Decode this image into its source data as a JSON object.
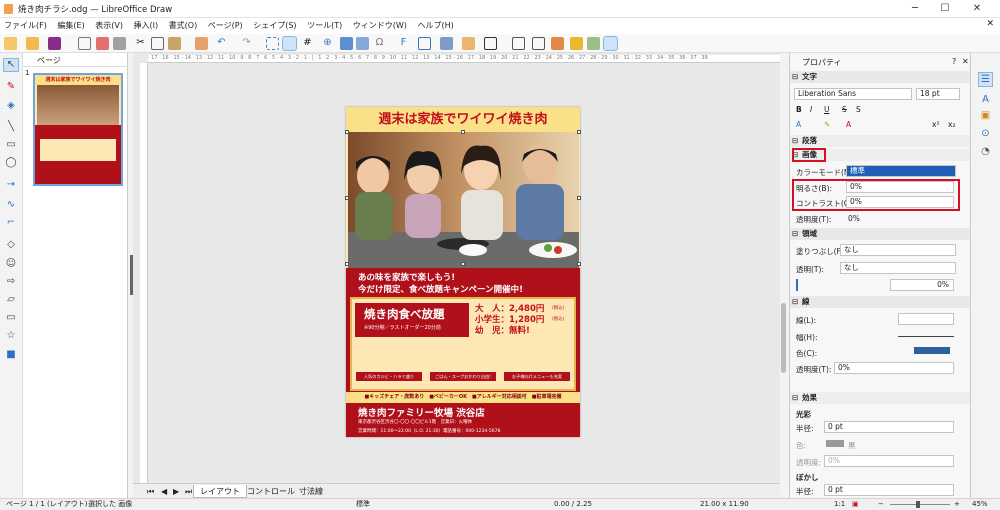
{
  "window": {
    "title": "焼き肉チラシ.odg — LibreOffice Draw",
    "minimize": "─",
    "maximize": "☐",
    "close": "✕"
  },
  "menu": [
    "ファイル(F)",
    "編集(E)",
    "表示(V)",
    "挿入(I)",
    "書式(O)",
    "ページ(P)",
    "シェイプ(S)",
    "ツール(T)",
    "ウィンドウ(W)",
    "ヘルプ(H)"
  ],
  "menu_close": "✕",
  "pages_panel": {
    "title": "ページ",
    "page_number": "1",
    "close": "✕"
  },
  "flyer": {
    "title": "週末は家族でワイワイ焼き肉",
    "tagline1": "あの味を家族で楽しもう!",
    "tagline2": "今だけ限定、食べ放題キャンペーン開催中!",
    "buffet": "焼き肉食べ放題",
    "buffet_note": "※90分制／ラストオーダー20分前",
    "price_adult": "大　人：2,480円",
    "price_child": "小学生：1,280円",
    "price_infant": "幼　児：無料!",
    "tax": "(税込)",
    "sub1": "人気のカルビ・ハラミ盛り",
    "sub2": "ごはん・スープおかわり自由!",
    "sub3": "お子様向けメニューも充実",
    "features": "■キッズチェア・席数あり　■ベビーカーOK　■アレルギー対応相談可　■駐車場完備",
    "store": "焼き肉ファミリー牧場 渋谷店",
    "address": "東京都渋谷区渋谷〇-〇〇-〇〇ビル1階　営業日：火曜休",
    "hours": "営業時間：11:00〜22:00（L.O. 21:30）電話番号：000-1234-5678"
  },
  "ruler_text": "· 17 · 16 · 15 · 14 · 13 · 12 · 11 · 10 · 9 · 8 · 7 · 6 · 5 · 4 · 3 · 2 · 1 · | · 1 · 2 · 3 · 4 · 5 · 6 · 7 · 8 · 9 · 10 · 11 · 12 · 13 · 14 · 15 · 16 · 17 · 18 · 19 · 20 · 21 · 22 · 23 · 24 · 25 · 26 · 27 · 28 · 29 · 30 · 31 · 32 · 33 · 34 · 35 · 36 · 37 · 38",
  "tabs": [
    "レイアウト",
    "コントロール",
    "寸法線"
  ],
  "tab_nav": [
    "⏮",
    "◀",
    "▶",
    "⏭"
  ],
  "properties": {
    "title": "プロパティ",
    "help": "?",
    "close": "✕",
    "character": {
      "label": "文字",
      "font": "Liberation Sans",
      "size": "18 pt"
    },
    "paragraph": {
      "label": "段落"
    },
    "image": {
      "label": "画像",
      "color_mode_label": "カラーモード(M):",
      "color_mode": "標準",
      "brightness_label": "明るさ(B):",
      "brightness": "0%",
      "contrast_label": "コントラスト(C):",
      "contrast": "0%",
      "transparency_label": "透明度(T):",
      "transparency": "0%"
    },
    "area": {
      "label": "領域",
      "fill_label": "塗りつぶし(F):",
      "fill": "なし",
      "transp_label": "透明(T):",
      "transp": "なし",
      "pct": "0%"
    },
    "line": {
      "label": "線",
      "style_label": "線(L):",
      "width_label": "幅(H):",
      "color_label": "色(C):",
      "transp_label": "透明度(T):",
      "transp": "0%"
    },
    "effects": {
      "label": "効果",
      "glow": "光彩",
      "radius_label": "半径:",
      "radius": "0 pt",
      "color_label": "色:",
      "color": "黒",
      "transp_label": "透明度:",
      "transp": "0%",
      "soft": "ぼかし",
      "soft_radius_label": "半径:",
      "soft_radius": "0 pt"
    }
  },
  "status": {
    "page": "ページ 1 / 1 (レイアウト)",
    "selection": "選択した 画像",
    "style": "標準",
    "position": "0.00 / 2.25",
    "size": "21.00 x 11.90",
    "scale": "1:1",
    "zoom": "45%"
  },
  "colors": {
    "accent": "#2d6fc0",
    "flyer_red": "#b0101a",
    "highlight": "#d51024"
  }
}
